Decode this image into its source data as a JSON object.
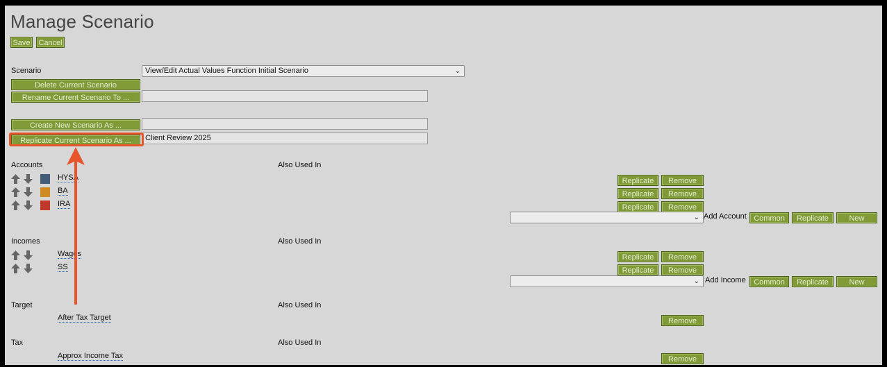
{
  "page": {
    "title": "Manage Scenario"
  },
  "toolbar": {
    "save_label": "Save",
    "cancel_label": "Cancel"
  },
  "scenario": {
    "label": "Scenario",
    "selected": "View/Edit Actual Values Function Initial Scenario",
    "delete_label": "Delete Current Scenario",
    "rename_label": "Rename Current Scenario To ...",
    "rename_value": "",
    "create_label": "Create New Scenario As ...",
    "create_value": "",
    "replicate_label": "Replicate Current Scenario As ...",
    "replicate_value": "Client Review 2025"
  },
  "accounts": {
    "header": "Accounts",
    "also_used_in": "Also Used In",
    "items": [
      {
        "name": "HYSA",
        "color": "#445c78"
      },
      {
        "name": "BA",
        "color": "#d08a22"
      },
      {
        "name": "IRA",
        "color": "#c0392b"
      }
    ],
    "add_select_value": "",
    "add_label": "Add Account"
  },
  "incomes": {
    "header": "Incomes",
    "also_used_in": "Also Used In",
    "items": [
      {
        "name": "Wages"
      },
      {
        "name": "SS"
      }
    ],
    "add_select_value": "",
    "add_label": "Add Income"
  },
  "target": {
    "header": "Target",
    "also_used_in": "Also Used In",
    "items": [
      {
        "name": "After Tax Target"
      }
    ]
  },
  "tax": {
    "header": "Tax",
    "also_used_in": "Also Used In",
    "items": [
      {
        "name": "Approx Income Tax"
      }
    ]
  },
  "actions": {
    "replicate": "Replicate",
    "remove": "Remove",
    "common": "Common",
    "new": "New"
  },
  "icons": {
    "up": "arrow-up-icon",
    "down": "arrow-down-icon",
    "dropdown": "chevron-down-icon"
  }
}
